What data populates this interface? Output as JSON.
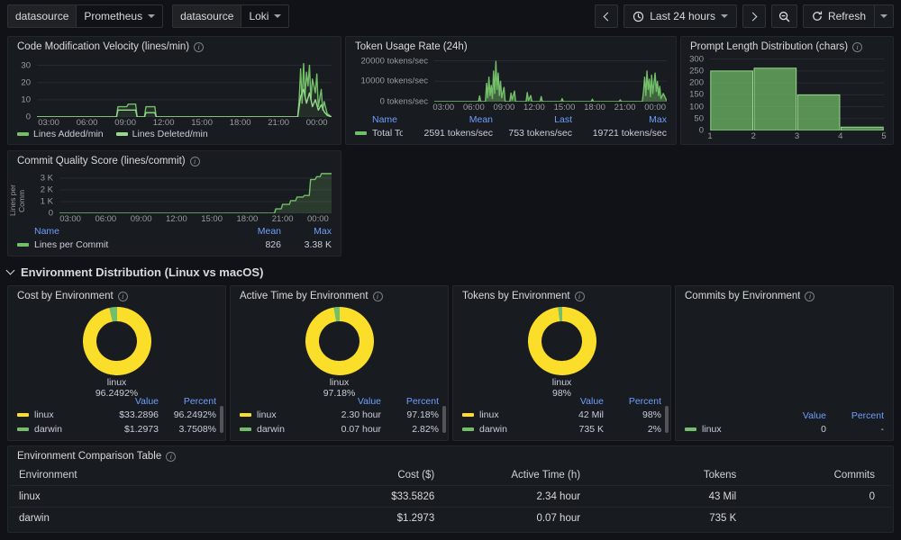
{
  "icons": {
    "info": "i"
  },
  "topbar": {
    "datasource_label": "datasource",
    "datasource1": "Prometheus",
    "datasource2": "Loki",
    "time_range": "Last 24 hours",
    "refresh_label": "Refresh"
  },
  "row_header": {
    "title": "Environment Distribution (Linux vs macOS)"
  },
  "panels": {
    "velocity": {
      "title": "Code Modification Velocity (lines/min)",
      "legend": [
        {
          "label": "Lines Added/min",
          "color": "#73BF69"
        },
        {
          "label": "Lines Deleted/min",
          "color": "#96D98D"
        }
      ],
      "chart": {
        "type": "line",
        "ymax": 35,
        "label_width": 22,
        "yticks": [
          0,
          10,
          20,
          30
        ],
        "xticks": [
          "03:00",
          "06:00",
          "09:00",
          "12:00",
          "15:00",
          "18:00",
          "21:00",
          "00:00"
        ],
        "xpos": [
          4,
          17,
          30,
          43,
          56,
          69,
          82,
          95
        ],
        "series": [
          {
            "name": "Lines Added/min",
            "color": "#73BF69",
            "fill": "rgba(115,191,105,0.12)",
            "points": [
              [
                0,
                0
              ],
              [
                0.27,
                0
              ],
              [
                0.275,
                6
              ],
              [
                0.305,
                6
              ],
              [
                0.31,
                7.5
              ],
              [
                0.335,
                7.5
              ],
              [
                0.34,
                0
              ],
              [
                0.365,
                0
              ],
              [
                0.37,
                6
              ],
              [
                0.4,
                6
              ],
              [
                0.405,
                0
              ],
              [
                0.885,
                0
              ],
              [
                0.89,
                10
              ],
              [
                0.895,
                28
              ],
              [
                0.9,
                8
              ],
              [
                0.905,
                31
              ],
              [
                0.91,
                12
              ],
              [
                0.915,
                26
              ],
              [
                0.92,
                18
              ],
              [
                0.925,
                30
              ],
              [
                0.93,
                10
              ],
              [
                0.935,
                22
              ],
              [
                0.945,
                14
              ],
              [
                0.95,
                25
              ],
              [
                0.955,
                6
              ],
              [
                0.965,
                16
              ],
              [
                0.97,
                4
              ],
              [
                0.975,
                9
              ],
              [
                0.985,
                2
              ],
              [
                1,
                0
              ]
            ]
          },
          {
            "name": "Lines Deleted/min",
            "color": "#96D98D",
            "points": [
              [
                0,
                0
              ],
              [
                0.27,
                0
              ],
              [
                0.275,
                4
              ],
              [
                0.335,
                4
              ],
              [
                0.34,
                0
              ],
              [
                0.365,
                0
              ],
              [
                0.37,
                2.5
              ],
              [
                0.4,
                2.5
              ],
              [
                0.405,
                0
              ],
              [
                0.885,
                0
              ],
              [
                0.895,
                12
              ],
              [
                0.905,
                16
              ],
              [
                0.915,
                8
              ],
              [
                0.925,
                14
              ],
              [
                0.935,
                6
              ],
              [
                0.945,
                10
              ],
              [
                0.955,
                4
              ],
              [
                0.965,
                7
              ],
              [
                0.975,
                3
              ],
              [
                0.985,
                1
              ],
              [
                1,
                0
              ]
            ]
          }
        ]
      }
    },
    "token": {
      "title": "Token Usage Rate (24h)",
      "legend_table": {
        "headers": [
          "Name",
          "Mean",
          "Last",
          "Max"
        ],
        "rows": [
          {
            "name": "Total Token Rate",
            "color": "#73BF69",
            "mean": "2591 tokens/sec",
            "last": "753 tokens/sec",
            "max": "19721 tokens/sec"
          }
        ]
      },
      "chart": {
        "type": "area",
        "ymax": 22000,
        "label_width": 88,
        "yticks": [
          {
            "v": 0,
            "label": "0 tokens/sec"
          },
          {
            "v": 10000,
            "label": "10000 tokens/sec"
          },
          {
            "v": 20000,
            "label": "20000 tokens/sec"
          }
        ],
        "xticks": [
          "03:00",
          "06:00",
          "09:00",
          "12:00",
          "15:00",
          "18:00",
          "21:00",
          "00:00"
        ],
        "xpos": [
          4,
          17,
          30,
          43,
          56,
          69,
          82,
          95
        ],
        "series": [
          {
            "name": "Total Token Rate",
            "color": "#73BF69",
            "fill": "rgba(115,191,105,0.45)",
            "points": [
              [
                0,
                0
              ],
              [
                0.19,
                0
              ],
              [
                0.195,
                2800
              ],
              [
                0.2,
                0
              ],
              [
                0.22,
                0
              ],
              [
                0.225,
                9000
              ],
              [
                0.23,
                2000
              ],
              [
                0.235,
                12000
              ],
              [
                0.24,
                3000
              ],
              [
                0.245,
                8000
              ],
              [
                0.25,
                1500
              ],
              [
                0.255,
                15000
              ],
              [
                0.26,
                4000
              ],
              [
                0.265,
                19721
              ],
              [
                0.27,
                6000
              ],
              [
                0.275,
                14000
              ],
              [
                0.28,
                3000
              ],
              [
                0.285,
                10000
              ],
              [
                0.29,
                2000
              ],
              [
                0.3,
                7000
              ],
              [
                0.305,
                0
              ],
              [
                0.325,
                0
              ],
              [
                0.33,
                4200
              ],
              [
                0.335,
                900
              ],
              [
                0.345,
                5200
              ],
              [
                0.35,
                0
              ],
              [
                0.395,
                0
              ],
              [
                0.4,
                4500
              ],
              [
                0.405,
                600
              ],
              [
                0.415,
                3000
              ],
              [
                0.42,
                0
              ],
              [
                0.455,
                0
              ],
              [
                0.46,
                2500
              ],
              [
                0.465,
                0
              ],
              [
                0.545,
                0
              ],
              [
                0.55,
                1500
              ],
              [
                0.555,
                0
              ],
              [
                0.675,
                0
              ],
              [
                0.68,
                1200
              ],
              [
                0.685,
                0
              ],
              [
                0.795,
                0
              ],
              [
                0.8,
                900
              ],
              [
                0.805,
                0
              ],
              [
                0.895,
                0
              ],
              [
                0.9,
                5000
              ],
              [
                0.905,
                12000
              ],
              [
                0.91,
                3000
              ],
              [
                0.915,
                15000
              ],
              [
                0.92,
                6000
              ],
              [
                0.925,
                11000
              ],
              [
                0.93,
                2500
              ],
              [
                0.935,
                13000
              ],
              [
                0.94,
                4000
              ],
              [
                0.945,
                9000
              ],
              [
                0.95,
                14000
              ],
              [
                0.955,
                5000
              ],
              [
                0.96,
                10000
              ],
              [
                0.965,
                3000
              ],
              [
                0.97,
                7500
              ],
              [
                0.975,
                1500
              ],
              [
                0.985,
                4000
              ],
              [
                1,
                500
              ]
            ]
          }
        ]
      }
    },
    "prompt": {
      "title": "Prompt Length Distribution (chars)",
      "chart": {
        "type": "histogram",
        "ymax": 310,
        "label_width": 22,
        "color": "#73BF69",
        "stroke": "#96D98D",
        "opacity": 0.72,
        "yticks": [
          0,
          50,
          100,
          150,
          200,
          250,
          300
        ],
        "xticks": [
          "1",
          "2",
          "3",
          "4",
          "5"
        ],
        "values": [
          250,
          262,
          150,
          14
        ]
      }
    },
    "commit": {
      "title": "Commit Quality Score (lines/commit)",
      "y_axis_label": "Lines per Comm",
      "legend_table": {
        "headers": [
          "Name",
          "Mean",
          "Max"
        ],
        "rows": [
          {
            "name": "Lines per Commit",
            "color": "#73BF69",
            "mean": "826",
            "max": "3.38 K"
          }
        ]
      },
      "chart": {
        "type": "area",
        "ymax": 3600,
        "label_width": 24,
        "yticks": [
          {
            "v": 0,
            "label": "0"
          },
          {
            "v": 1000,
            "label": "1 K"
          },
          {
            "v": 2000,
            "label": "2 K"
          },
          {
            "v": 3000,
            "label": "3 K"
          }
        ],
        "xticks": [
          "03:00",
          "06:00",
          "09:00",
          "12:00",
          "15:00",
          "18:00",
          "21:00",
          "00:00"
        ],
        "xpos": [
          4,
          17,
          30,
          43,
          56,
          69,
          82,
          95
        ],
        "series": [
          {
            "name": "Lines per Commit",
            "color": "#73BF69",
            "fill": "rgba(115,191,105,0.2)",
            "points": [
              [
                0,
                0
              ],
              [
                0.79,
                0
              ],
              [
                0.795,
                380
              ],
              [
                0.815,
                380
              ],
              [
                0.82,
                760
              ],
              [
                0.845,
                760
              ],
              [
                0.85,
                1080
              ],
              [
                0.868,
                1080
              ],
              [
                0.873,
                1380
              ],
              [
                0.895,
                1380
              ],
              [
                0.9,
                1520
              ],
              [
                0.918,
                1520
              ],
              [
                0.923,
                2880
              ],
              [
                0.94,
                2880
              ],
              [
                0.945,
                3120
              ],
              [
                0.958,
                3120
              ],
              [
                0.963,
                3380
              ],
              [
                1,
                3380
              ]
            ]
          }
        ]
      }
    },
    "cost": {
      "title": "Cost by Environment",
      "donut": {
        "type": "donut",
        "slices": [
          {
            "name": "linux",
            "color": "#FADE2A",
            "percent": 96.2492
          },
          {
            "name": "darwin",
            "color": "#73BF69",
            "percent": 3.7508
          }
        ]
      },
      "center_label": {
        "name": "linux",
        "percent": "96.2492%"
      },
      "legend": {
        "headers": [
          "Value",
          "Percent"
        ],
        "rows": [
          {
            "name": "linux",
            "color": "#FADE2A",
            "value": "$33.2896",
            "percent": "96.2492%"
          },
          {
            "name": "darwin",
            "color": "#73BF69",
            "value": "$1.2973",
            "percent": "3.7508%"
          }
        ]
      }
    },
    "active": {
      "title": "Active Time by Environment",
      "donut": {
        "type": "donut",
        "slices": [
          {
            "name": "linux",
            "color": "#FADE2A",
            "percent": 97.18
          },
          {
            "name": "darwin",
            "color": "#73BF69",
            "percent": 2.82
          }
        ]
      },
      "center_label": {
        "name": "linux",
        "percent": "97.18%"
      },
      "legend": {
        "headers": [
          "Value",
          "Percent"
        ],
        "rows": [
          {
            "name": "linux",
            "color": "#FADE2A",
            "value": "2.30 hour",
            "percent": "97.18%"
          },
          {
            "name": "darwin",
            "color": "#73BF69",
            "value": "0.07 hour",
            "percent": "2.82%"
          }
        ]
      }
    },
    "tokens_env": {
      "title": "Tokens by Environment",
      "donut": {
        "type": "donut",
        "slices": [
          {
            "name": "linux",
            "color": "#FADE2A",
            "percent": 98
          },
          {
            "name": "darwin",
            "color": "#73BF69",
            "percent": 2
          }
        ]
      },
      "center_label": {
        "name": "linux",
        "percent": "98%"
      },
      "legend": {
        "headers": [
          "Value",
          "Percent"
        ],
        "rows": [
          {
            "name": "linux",
            "color": "#FADE2A",
            "value": "42 Mil",
            "percent": "98%"
          },
          {
            "name": "darwin",
            "color": "#73BF69",
            "value": "735 K",
            "percent": "2%"
          }
        ]
      }
    },
    "commits_env": {
      "title": "Commits by Environment",
      "legend": {
        "headers": [
          "Value",
          "Percent"
        ],
        "rows": [
          {
            "name": "linux",
            "color": "#73BF69",
            "value": "0",
            "percent": "-"
          }
        ]
      }
    },
    "comparison": {
      "title": "Environment Comparison Table",
      "headers": [
        "Environment",
        "Cost ($)",
        "Active Time (h)",
        "Tokens",
        "Commits"
      ],
      "rows": [
        [
          "linux",
          "$33.5826",
          "2.34 hour",
          "43 Mil",
          "0"
        ],
        [
          "darwin",
          "$1.2973",
          "0.07 hour",
          "735 K",
          ""
        ]
      ]
    }
  }
}
